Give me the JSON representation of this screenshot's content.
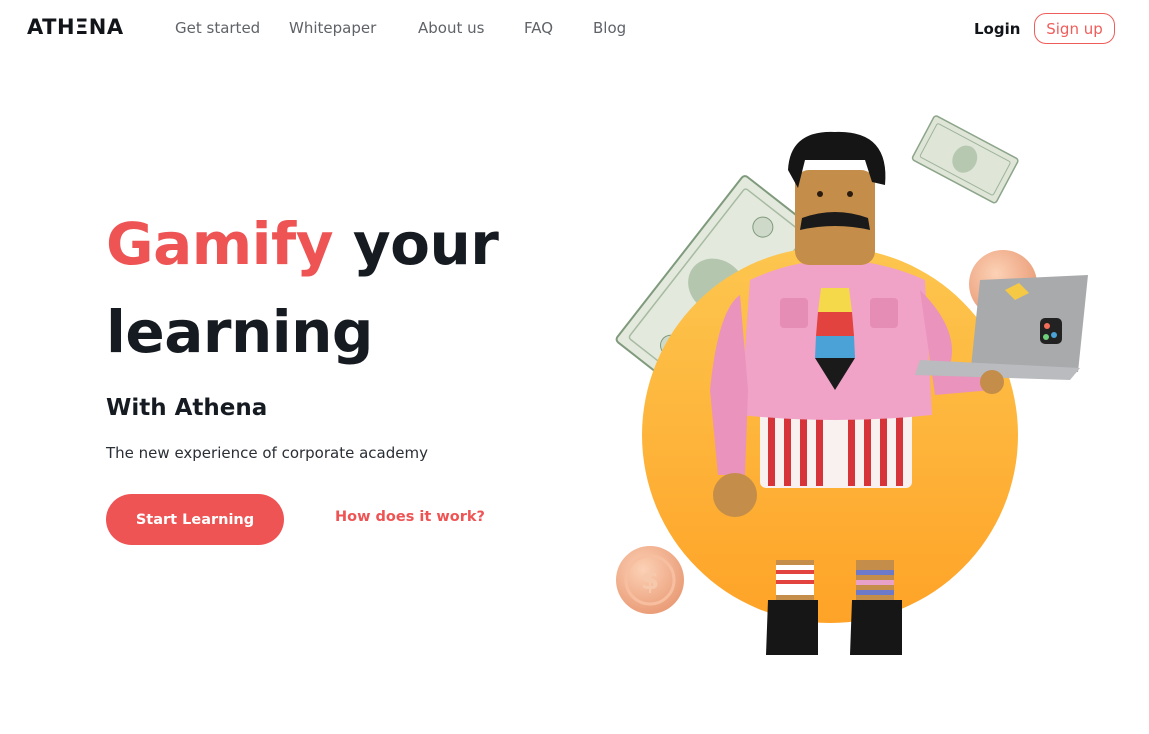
{
  "brand": {
    "logo": "ATHΞNA"
  },
  "nav": {
    "items": [
      "Get started",
      "Whitepaper",
      "About us",
      "FAQ",
      "Blog"
    ]
  },
  "auth": {
    "login": "Login",
    "signup": "Sign up"
  },
  "hero": {
    "headline_accent": "Gamify",
    "headline_rest": "your",
    "headline_line2": "learning",
    "subheading": "With Athena",
    "tagline": "The new experience of corporate academy",
    "primary_cta": "Start Learning",
    "secondary_cta": "How does it work?"
  },
  "illustration": {
    "subject": "3D character with mustache holding laptop",
    "coin_symbol": "$",
    "icons": [
      "dollar-bill-icon",
      "coin-icon",
      "laptop-icon"
    ]
  },
  "colors": {
    "accent": "#ef5455",
    "text_dark": "#161b22",
    "nav_text": "#5f6368",
    "sun_circle": "#fdb53a",
    "shirt": "#f0a2c7"
  }
}
